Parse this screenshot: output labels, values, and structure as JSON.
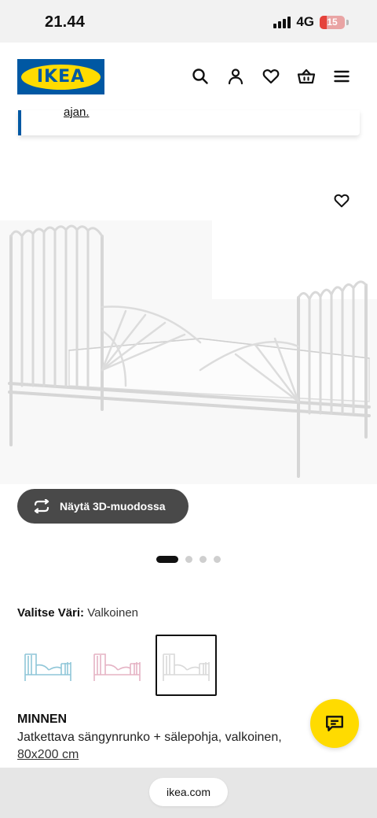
{
  "status_bar": {
    "time": "21.44",
    "network": "4G",
    "battery": "15"
  },
  "header": {
    "logo_text": "IKEA",
    "icons": [
      "search-icon",
      "user-icon",
      "heart-icon",
      "basket-icon",
      "menu-icon"
    ]
  },
  "notice": {
    "link_text": "ajan."
  },
  "product": {
    "view_3d_label": "Näytä 3D-muodossa",
    "gallery": {
      "image_count": 4,
      "active_index": 0
    },
    "color_label": "Valitse Väri:",
    "color_value": "Valkoinen",
    "swatches": [
      {
        "color": "#8fc6d8",
        "selected": false
      },
      {
        "color": "#e5b3c4",
        "selected": false
      },
      {
        "color": "#d9d9d9",
        "selected": true
      }
    ],
    "name": "MINNEN",
    "description": "Jatkettava sängynrunko + sälepohja, valkoinen,",
    "size_link": "80x200 cm"
  },
  "browser": {
    "url": "ikea.com"
  },
  "colors": {
    "ikea_blue": "#0058a3",
    "ikea_yellow": "#ffdb00"
  }
}
